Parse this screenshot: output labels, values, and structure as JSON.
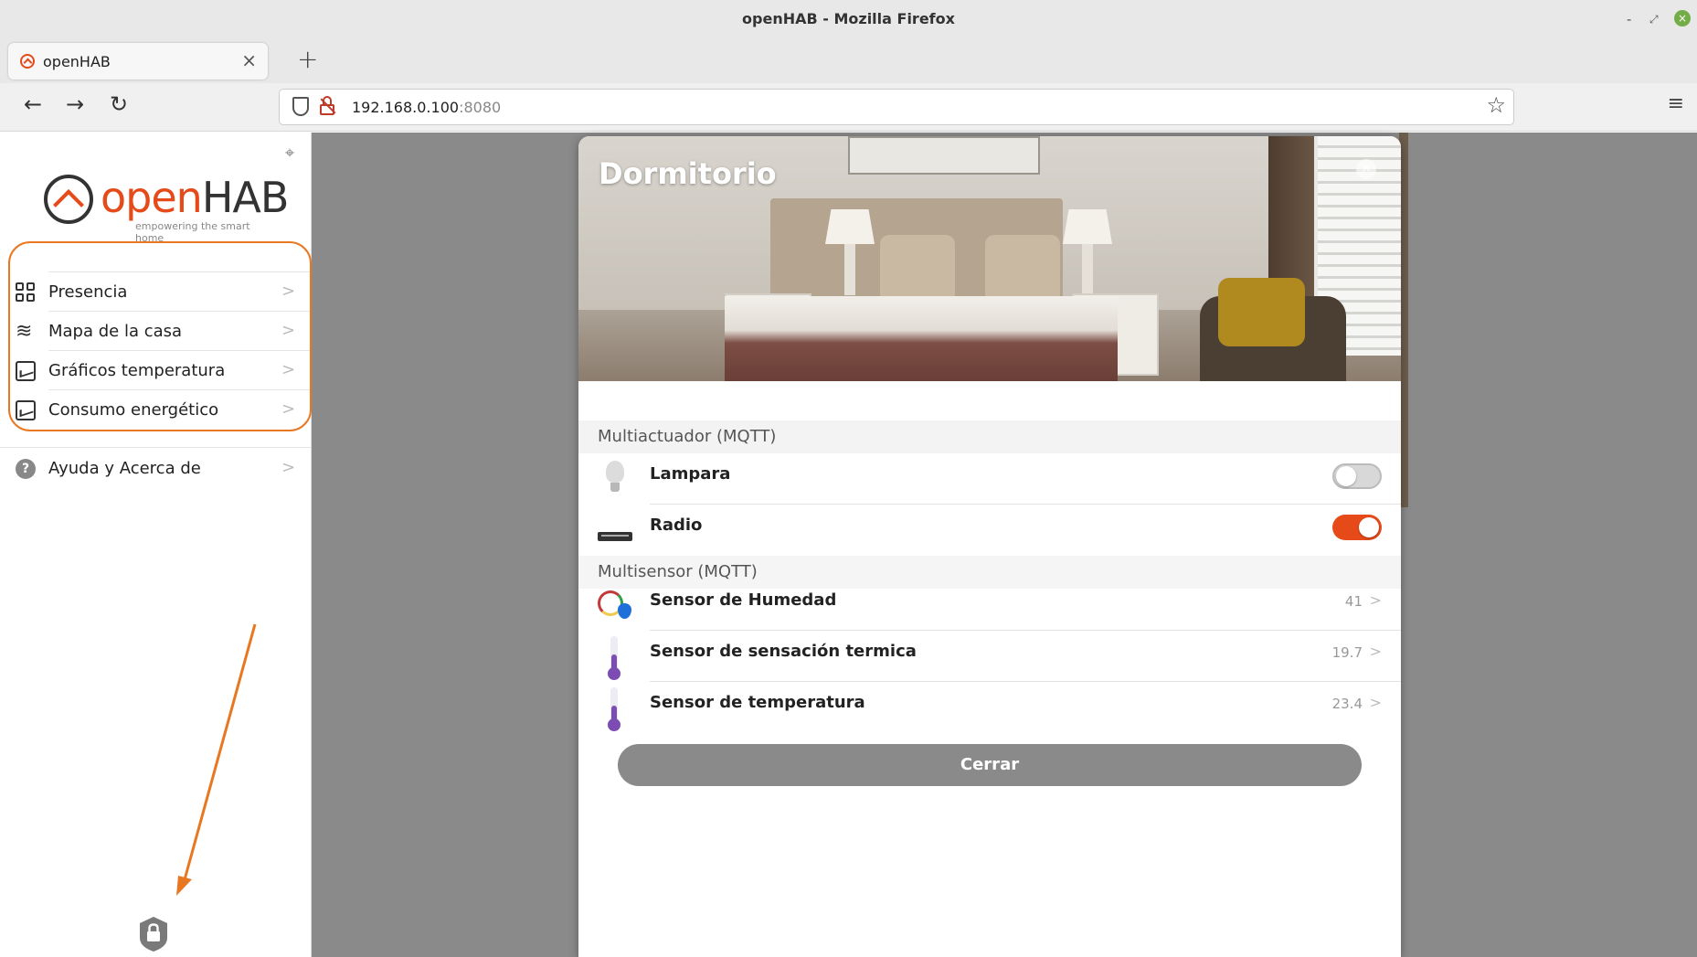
{
  "window": {
    "title": "openHAB - Mozilla Firefox",
    "minimize": "-",
    "maximize": "⤢",
    "close": "×"
  },
  "tabs": [
    {
      "label": "openHAB",
      "close": "×"
    }
  ],
  "newtab": "+",
  "nav": {
    "back": "←",
    "forward": "→",
    "reload": "↻",
    "url_host": "192.168.0.100",
    "url_port": ":8080",
    "star": "☆",
    "menu": "≡"
  },
  "sidebar": {
    "pin": "⌖",
    "logo": {
      "open": "open",
      "hab": "HAB",
      "tagline": "empowering the smart home"
    },
    "items": [
      {
        "label": "Presencia",
        "icon": "grid-icon"
      },
      {
        "label": "Mapa de la casa",
        "icon": "layers-icon"
      },
      {
        "label": "Gráficos temperatura",
        "icon": "chart-icon"
      },
      {
        "label": "Consumo energético",
        "icon": "chart-icon"
      }
    ],
    "help": {
      "label": "Ayuda y Acerca de",
      "icon": "help-icon",
      "glyph": "?"
    },
    "chevron": ">",
    "annotation_color": "#e87722"
  },
  "modal": {
    "title": "Dormitorio",
    "close_x": "×",
    "sections": [
      {
        "header": "Multiactuador (MQTT)",
        "rows": [
          {
            "label": "Lampara",
            "type": "switch",
            "state": "off",
            "icon": "bulb-icon"
          },
          {
            "label": "Radio",
            "type": "switch",
            "state": "on",
            "icon": "radio-icon"
          }
        ]
      },
      {
        "header": "Multisensor (MQTT)",
        "rows": [
          {
            "label": "Sensor de Humedad",
            "value": "41",
            "icon": "humidity-icon"
          },
          {
            "label": "Sensor de sensación termica",
            "value": "19.7",
            "icon": "thermometer-icon"
          },
          {
            "label": "Sensor de temperatura",
            "value": "23.4",
            "icon": "thermometer-icon"
          }
        ]
      }
    ],
    "close_button": "Cerrar"
  },
  "colors": {
    "accent": "#e64a19",
    "annotation": "#e87722",
    "backdrop": "#8a8a8a"
  }
}
